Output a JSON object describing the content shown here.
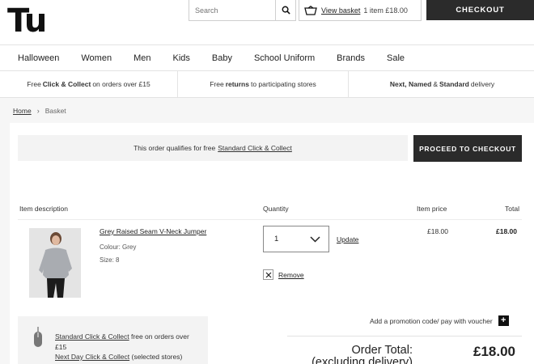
{
  "header": {
    "logo": "Tu",
    "search_placeholder": "Search",
    "basket_link": "View basket",
    "basket_count": "1 item £18.00",
    "checkout_label": "CHECKOUT"
  },
  "nav": [
    "Halloween",
    "Women",
    "Men",
    "Kids",
    "Baby",
    "School Uniform",
    "Brands",
    "Sale"
  ],
  "benefits": {
    "b1_pre": "Free",
    "b1_bold": "Click & Collect",
    "b1_post": "on orders over £15",
    "b2_pre": "Free",
    "b2_bold": "returns",
    "b2_post": "to participating stores",
    "b3_bold1": "Next, Named",
    "b3_mid": "&",
    "b3_bold2": "Standard",
    "b3_post": "delivery"
  },
  "breadcrumb": {
    "home": "Home",
    "current": "Basket"
  },
  "qualifies": {
    "text": "This order qualifies for free",
    "link": "Standard Click & Collect"
  },
  "proceed_label": "PROCEED TO CHECKOUT",
  "table_headers": {
    "description": "Item description",
    "quantity": "Quantity",
    "price": "Item price",
    "total": "Total"
  },
  "item": {
    "name": "Grey Raised Seam V-Neck Jumper",
    "colour": "Colour: Grey",
    "size": "Size: 8",
    "quantity": "1",
    "update": "Update",
    "remove": "Remove",
    "price": "£18.00",
    "total": "£18.00"
  },
  "delivery": {
    "line1_link": "Standard Click & Collect",
    "line1_rest": "free on orders over £15",
    "line2_link": "Next Day Click & Collect",
    "line2_rest": "(selected stores)"
  },
  "promo": "Add a promotion code/ pay with voucher",
  "order_total": {
    "label": "Order Total: (excluding delivery)",
    "value": "£18.00"
  },
  "colors": {
    "dark_button": "#2b2b2b",
    "page_bg": "#f6f6f6"
  }
}
